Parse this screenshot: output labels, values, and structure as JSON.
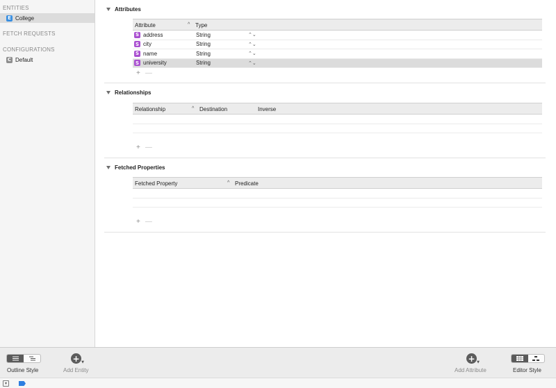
{
  "sidebar": {
    "entities_header": "ENTITIES",
    "entities": [
      {
        "label": "College",
        "badge": "E"
      }
    ],
    "fetch_requests_header": "FETCH REQUESTS",
    "configurations_header": "CONFIGURATIONS",
    "configurations": [
      {
        "label": "Default",
        "badge": "C"
      }
    ]
  },
  "attributes": {
    "title": "Attributes",
    "columns": {
      "attribute": "Attribute",
      "type": "Type"
    },
    "rows": [
      {
        "badge": "S",
        "name": "address",
        "type": "String"
      },
      {
        "badge": "S",
        "name": "city",
        "type": "String"
      },
      {
        "badge": "S",
        "name": "name",
        "type": "String"
      },
      {
        "badge": "S",
        "name": "university",
        "type": "String"
      }
    ],
    "selected_row": 3
  },
  "relationships": {
    "title": "Relationships",
    "columns": {
      "relationship": "Relationship",
      "destination": "Destination",
      "inverse": "Inverse"
    }
  },
  "fetched_properties": {
    "title": "Fetched Properties",
    "columns": {
      "fetched_property": "Fetched Property",
      "predicate": "Predicate"
    }
  },
  "controls": {
    "add": "+",
    "remove": "—",
    "sort_caret": "^",
    "stepper": "⌃⌄"
  },
  "toolbar": {
    "outline_style_label": "Outline Style",
    "add_entity_label": "Add Entity",
    "add_attribute_label": "Add Attribute",
    "editor_style_label": "Editor Style",
    "add_symbol": "+"
  },
  "icons": {
    "outline-list": "list-icon",
    "outline-tree": "tree-icon",
    "editor-table": "table-grid-icon",
    "editor-graph": "graph-icon"
  },
  "colors": {
    "entity_badge": "#3a8fe0",
    "attribute_badge": "#a94fd0",
    "config_badge": "#8e8e8e",
    "status_flag": "#2d7ee0"
  }
}
